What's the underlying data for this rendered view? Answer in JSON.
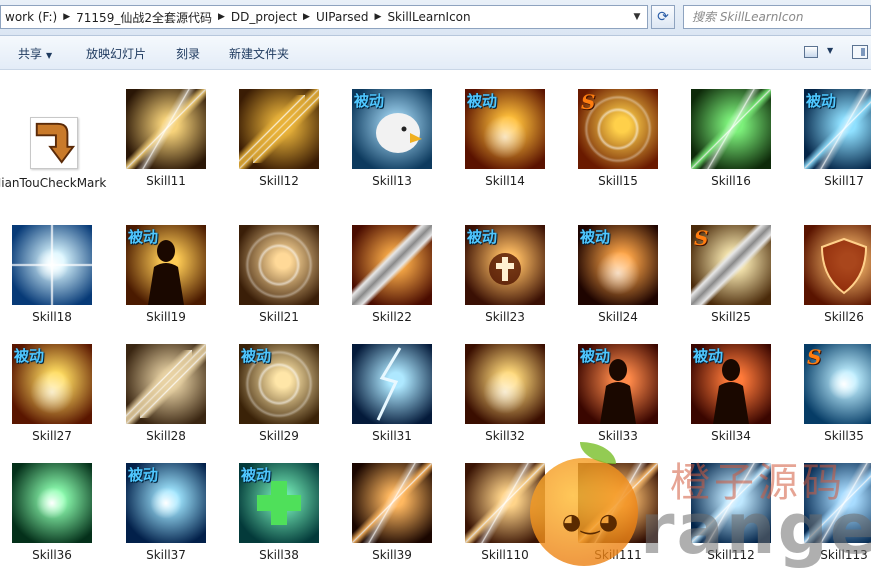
{
  "address": {
    "crumbs": [
      "work (F:)",
      "71159_仙战2全套源代码",
      "DD_project",
      "UIParsed",
      "SkillLearnIcon"
    ]
  },
  "search": {
    "placeholder": "搜索 SkillLearnIcon"
  },
  "toolbar": {
    "share": "共享",
    "slideshow": "放映幻灯片",
    "burn": "刻录",
    "new_folder": "新建文件夹"
  },
  "badges": {
    "passive": "被动",
    "special": "S"
  },
  "files": [
    {
      "name": "JianTouCheckMark",
      "kind": "arrow"
    },
    {
      "name": "Skill11",
      "theme": "dart",
      "c1": "#f6d27a",
      "c2": "#2a1606"
    },
    {
      "name": "Skill12",
      "theme": "darts",
      "c1": "#e8b23a",
      "c2": "#3a1c04"
    },
    {
      "name": "Skill13",
      "theme": "eagle",
      "c1": "#9fd3f0",
      "c2": "#0d3a5e",
      "badge": "passive"
    },
    {
      "name": "Skill14",
      "theme": "boot",
      "c1": "#ffbf3a",
      "c2": "#5a1200",
      "badge": "passive"
    },
    {
      "name": "Skill15",
      "theme": "swirl",
      "c1": "#ffd04a",
      "c2": "#6a1a00",
      "badge": "special"
    },
    {
      "name": "Skill16",
      "theme": "spear",
      "c1": "#7cf07a",
      "c2": "#0e2a0a"
    },
    {
      "name": "Skill17",
      "theme": "spear-blue",
      "c1": "#8fe0ff",
      "c2": "#032447",
      "badge": "passive"
    },
    {
      "name": "Skill18",
      "theme": "star",
      "c1": "#d9f6ff",
      "c2": "#073a77"
    },
    {
      "name": "Skill19",
      "theme": "silhouette",
      "c1": "#ffcc55",
      "c2": "#4a1a00",
      "badge": "passive"
    },
    {
      "name": "Skill21",
      "theme": "whirl",
      "c1": "#ffd998",
      "c2": "#3a1e08"
    },
    {
      "name": "Skill22",
      "theme": "sword",
      "c1": "#ffb04a",
      "c2": "#4a0c00"
    },
    {
      "name": "Skill23",
      "theme": "cross",
      "c1": "#ffbe64",
      "c2": "#3a1004",
      "badge": "passive"
    },
    {
      "name": "Skill24",
      "theme": "flame",
      "c1": "#ffa648",
      "c2": "#1e0400",
      "badge": "passive"
    },
    {
      "name": "Skill25",
      "theme": "blade",
      "c1": "#fff0b8",
      "c2": "#4a2a0a",
      "badge": "special"
    },
    {
      "name": "Skill26",
      "theme": "shield",
      "c1": "#ffc070",
      "c2": "#5a1400"
    },
    {
      "name": "Skill27",
      "theme": "burst",
      "c1": "#ffdc60",
      "c2": "#5a1600",
      "badge": "passive"
    },
    {
      "name": "Skill28",
      "theme": "blades",
      "c1": "#e8d2a4",
      "c2": "#3a2612"
    },
    {
      "name": "Skill29",
      "theme": "wheel",
      "c1": "#ffe6a8",
      "c2": "#3a2208",
      "badge": "passive"
    },
    {
      "name": "Skill31",
      "theme": "lightning",
      "c1": "#aee8ff",
      "c2": "#041a3a"
    },
    {
      "name": "Skill32",
      "theme": "beam",
      "c1": "#ffd97a",
      "c2": "#3a0e00"
    },
    {
      "name": "Skill33",
      "theme": "hand",
      "c1": "#ff8a4a",
      "c2": "#3a0600",
      "badge": "passive"
    },
    {
      "name": "Skill34",
      "theme": "silhouette",
      "c1": "#ff7a3a",
      "c2": "#3a0600",
      "badge": "passive"
    },
    {
      "name": "Skill35",
      "theme": "orb",
      "c1": "#bdeeff",
      "c2": "#063c66",
      "badge": "special"
    },
    {
      "name": "Skill36",
      "theme": "heal",
      "c1": "#8dffb0",
      "c2": "#04301a"
    },
    {
      "name": "Skill37",
      "theme": "orb",
      "c1": "#9fe6ff",
      "c2": "#02204a",
      "badge": "passive"
    },
    {
      "name": "Skill38",
      "theme": "plus",
      "c1": "#6fe3b0",
      "c2": "#033a3a",
      "badge": "passive"
    },
    {
      "name": "Skill39",
      "theme": "meteor",
      "c1": "#ffb860",
      "c2": "#1a0600"
    },
    {
      "name": "Skill110",
      "theme": "dart",
      "c1": "#ffd48a",
      "c2": "#3a1404"
    },
    {
      "name": "Skill111",
      "theme": "streak",
      "c1": "#ffc070",
      "c2": "#2a0800"
    },
    {
      "name": "Skill112",
      "theme": "streak",
      "c1": "#bfe8ff",
      "c2": "#03254a"
    },
    {
      "name": "Skill113",
      "theme": "streak",
      "c1": "#a8dcff",
      "c2": "#052a52"
    }
  ],
  "watermark": {
    "cn": "橙子源码",
    "en": "range"
  }
}
